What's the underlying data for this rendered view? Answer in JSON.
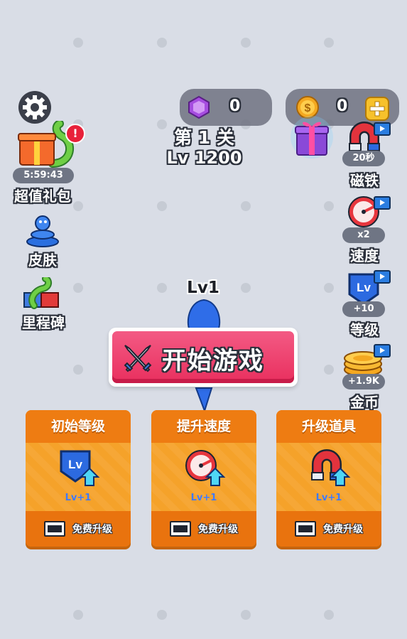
{
  "currency": {
    "gems": "0",
    "coins": "0"
  },
  "level": {
    "stage": "第 1 关",
    "lv": "Lv 1200"
  },
  "left_menu": {
    "gift_timer": "5:59:43",
    "gift_label": "超值礼包",
    "skin_label": "皮肤",
    "milestone_label": "里程碑"
  },
  "right_menu": [
    {
      "badge": "20秒",
      "label": "磁铁",
      "icon": "magnet-icon"
    },
    {
      "badge": "x2",
      "label": "速度",
      "icon": "speedometer-icon"
    },
    {
      "badge": "+10",
      "label": "等级",
      "icon": "lv-shield-icon"
    },
    {
      "badge": "+1.9K",
      "label": "金币",
      "icon": "coin-stack-icon"
    }
  ],
  "player": {
    "level_tag": "Lv1"
  },
  "start_button": {
    "label": "开始游戏"
  },
  "upgrade_cards": [
    {
      "title": "初始等级",
      "level": "Lv+1",
      "action": "免费升级",
      "icon": "lv-shield-up-icon"
    },
    {
      "title": "提升速度",
      "level": "Lv+1",
      "action": "免费升级",
      "icon": "speedometer-up-icon"
    },
    {
      "title": "升级道具",
      "level": "Lv+1",
      "action": "免费升级",
      "icon": "magnet-up-icon"
    }
  ],
  "colors": {
    "background": "#d9dde6",
    "start_button": "#f0416e",
    "card": "#f39a1b",
    "gem": "#a64de0",
    "coin": "#f4a820"
  }
}
